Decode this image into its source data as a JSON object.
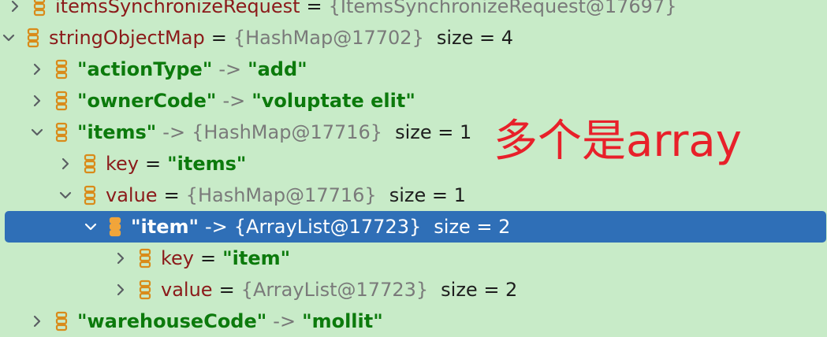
{
  "rows": [
    {
      "name": "itemsSynchronizeRequest",
      "op": "=",
      "ref": "{ItemsSynchronizeRequest@17697}",
      "expanded": false
    },
    {
      "name": "stringObjectMap",
      "op": "=",
      "ref": "{HashMap@17702}",
      "size": "size = 4",
      "expanded": true
    },
    {
      "key": "\"actionType\"",
      "arrow": "->",
      "value": "\"add\"",
      "expanded": false
    },
    {
      "key": "\"ownerCode\"",
      "arrow": "->",
      "value": "\"voluptate elit\"",
      "expanded": false
    },
    {
      "key": "\"items\"",
      "arrow": "->",
      "ref": "{HashMap@17716}",
      "size": "size = 1",
      "expanded": true
    },
    {
      "name": "key",
      "op": "=",
      "value": "\"items\"",
      "expanded": false
    },
    {
      "name": "value",
      "op": "=",
      "ref": "{HashMap@17716}",
      "size": "size = 1",
      "expanded": true
    },
    {
      "key": "\"item\"",
      "arrow": "->",
      "ref": "{ArrayList@17723}",
      "size": "size = 2",
      "expanded": true,
      "selected": true
    },
    {
      "name": "key",
      "op": "=",
      "value": "\"item\"",
      "expanded": false
    },
    {
      "name": "value",
      "op": "=",
      "ref": "{ArrayList@17723}",
      "size": "size = 2",
      "expanded": false
    },
    {
      "key": "\"warehouseCode\"",
      "arrow": "->",
      "value": "\"mollit\"",
      "expanded": false
    }
  ],
  "annotation": "多个是array",
  "colors": {
    "background": "#c8ebc8",
    "selection": "#2f6fb7",
    "annotation": "#e8202a",
    "string": "#0c7a0c",
    "field_name": "#8b1a1a"
  },
  "icons": {
    "expand": "chevron-right-icon",
    "collapse": "chevron-down-icon",
    "field": "database-field-icon"
  }
}
